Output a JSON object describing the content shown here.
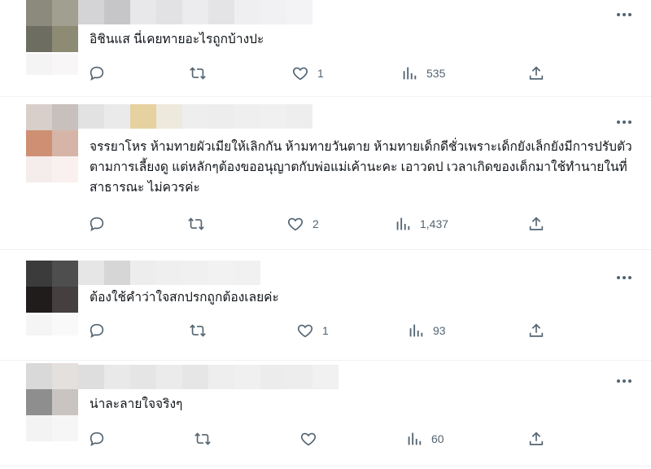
{
  "tweets": [
    {
      "text": "อิชินแส นี่เคยทายอะไรถูกบ้างปะ",
      "replies": "",
      "retweets": "",
      "likes": "1",
      "views": "535"
    },
    {
      "text": "จรรยาโหร ห้ามทายผัวเมียให้เลิกกัน ห้ามทายวันตาย ห้ามทายเด็กดีชั่วเพราะเด็กยังเล็กยังมีการปรับตัวตามการเลี้ยงดู แต่หลักๆต้องขออนุญาตกับพ่อแม่เค้านะคะ เอาวดป เวลาเกิดของเด็กมาใช้ทำนายในที่สาธารณะ ไม่ควรค่ะ",
      "replies": "",
      "retweets": "",
      "likes": "2",
      "views": "1,437"
    },
    {
      "text": "ต้องใช้คำว่าใจสกปรกถูกต้องเลยค่ะ",
      "replies": "",
      "retweets": "",
      "likes": "1",
      "views": "93"
    },
    {
      "text": "น่าละลายใจจริงๆ",
      "replies": "",
      "retweets": "",
      "likes": "",
      "views": "60"
    }
  ],
  "icons": {
    "reply": "reply-icon",
    "retweet": "retweet-icon",
    "like": "heart-icon",
    "views": "views-icon",
    "share": "share-icon",
    "more": "more-icon"
  },
  "colors": {
    "icon": "#536471",
    "text": "#0f1419",
    "divider": "#eff3f4"
  }
}
